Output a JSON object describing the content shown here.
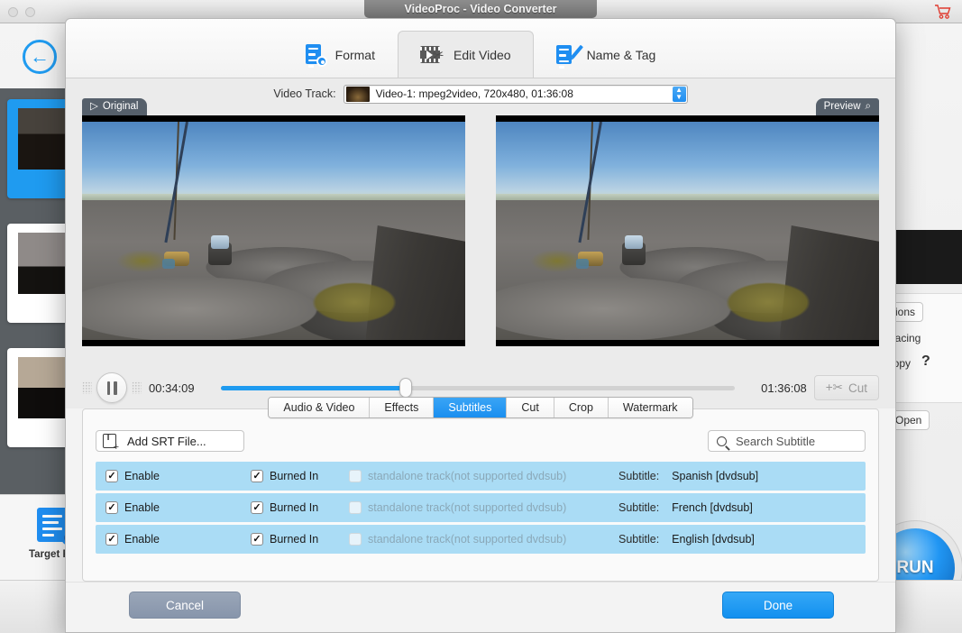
{
  "window": {
    "title": "VideoProc - Video Converter",
    "cart_icon": "shopping-cart-icon"
  },
  "background": {
    "back_label": "B",
    "target_format_label": "Target For",
    "run_label": "RUN",
    "right_panel": {
      "options_label": "otions",
      "deinterlacing_label": "terlacing",
      "copy_label": "Copy",
      "help_label": "?",
      "open_label": "Open"
    }
  },
  "dialog": {
    "tabs": [
      {
        "label": "Format",
        "icon": "format-doc-gear-icon",
        "active": false
      },
      {
        "label": "Edit Video",
        "icon": "film-scissors-icon",
        "active": true
      },
      {
        "label": "Name & Tag",
        "icon": "doc-pencil-icon",
        "active": false
      }
    ],
    "track": {
      "label": "Video Track:",
      "value": "Video-1: mpeg2video, 720x480, 01:36:08",
      "stepper_up": "▲",
      "stepper_down": "▼"
    },
    "preview": {
      "original_badge": "Original",
      "original_icon": "play-triangle-icon",
      "preview_badge": "Preview",
      "preview_icon": "magnifier-icon"
    },
    "transport": {
      "play_state_icon": "pause-icon",
      "current_time": "00:34:09",
      "total_time": "01:36:08",
      "progress_percent": 36,
      "cut_label": "Cut",
      "cut_icon": "add-scissors-icon"
    },
    "edit_tabs": [
      {
        "label": "Audio & Video",
        "active": false
      },
      {
        "label": "Effects",
        "active": false
      },
      {
        "label": "Subtitles",
        "active": true
      },
      {
        "label": "Cut",
        "active": false
      },
      {
        "label": "Crop",
        "active": false
      },
      {
        "label": "Watermark",
        "active": false
      }
    ],
    "subtitle_panel": {
      "add_srt_label": "Add SRT File...",
      "add_srt_icon": "add-subtitle-file-icon",
      "search_placeholder": "Search Subtitle",
      "search_value": "",
      "search_icon": "search-icon",
      "column_labels": {
        "enable": "Enable",
        "burned_in": "Burned In",
        "standalone": "standalone track(not supported dvdsub)",
        "subtitle": "Subtitle:"
      },
      "rows": [
        {
          "enable": true,
          "burned_in": true,
          "standalone": false,
          "standalone_label": "standalone track(not supported dvdsub)",
          "subtitle_label": "Subtitle:",
          "subtitle_value": "Spanish [dvdsub]"
        },
        {
          "enable": true,
          "burned_in": true,
          "standalone": false,
          "standalone_label": "standalone track(not supported dvdsub)",
          "subtitle_label": "Subtitle:",
          "subtitle_value": "French [dvdsub]"
        },
        {
          "enable": true,
          "burned_in": true,
          "standalone": false,
          "standalone_label": "standalone track(not supported dvdsub)",
          "subtitle_label": "Subtitle:",
          "subtitle_value": "English [dvdsub]"
        }
      ]
    },
    "footer": {
      "cancel_label": "Cancel",
      "done_label": "Done"
    }
  },
  "colors": {
    "accent_blue": "#1f9bf0",
    "row_blue": "#aadcf5",
    "cancel_gray": "#8795ab",
    "title_gray": "#7a7a7a"
  }
}
